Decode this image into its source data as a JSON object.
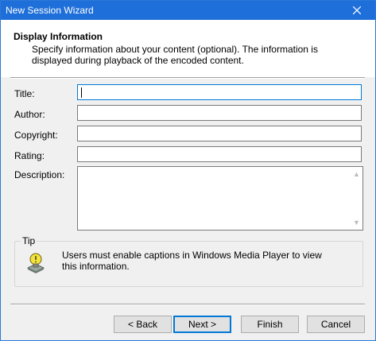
{
  "window": {
    "title": "New Session Wizard"
  },
  "header": {
    "heading": "Display Information",
    "description": "Specify information about your content (optional). The information is displayed during playback of the encoded content."
  },
  "form": {
    "title_label": "Title:",
    "title_value": "",
    "author_label": "Author:",
    "author_value": "",
    "copyright_label": "Copyright:",
    "copyright_value": "",
    "rating_label": "Rating:",
    "rating_value": "",
    "description_label": "Description:",
    "description_value": ""
  },
  "tip": {
    "legend": "Tip",
    "icon": "lightbulb-tip-icon",
    "text": "Users must enable captions in Windows Media Player to view this information."
  },
  "buttons": {
    "back": "< Back",
    "next": "Next >",
    "finish": "Finish",
    "cancel": "Cancel"
  },
  "icons": {
    "close": "close-icon",
    "scroll_up": "scroll-up-arrow-icon",
    "scroll_down": "scroll-down-arrow-icon"
  },
  "colors": {
    "titlebar": "#1e6fd9",
    "focus": "#0078d7",
    "dialog_bg": "#f0f0f0"
  }
}
